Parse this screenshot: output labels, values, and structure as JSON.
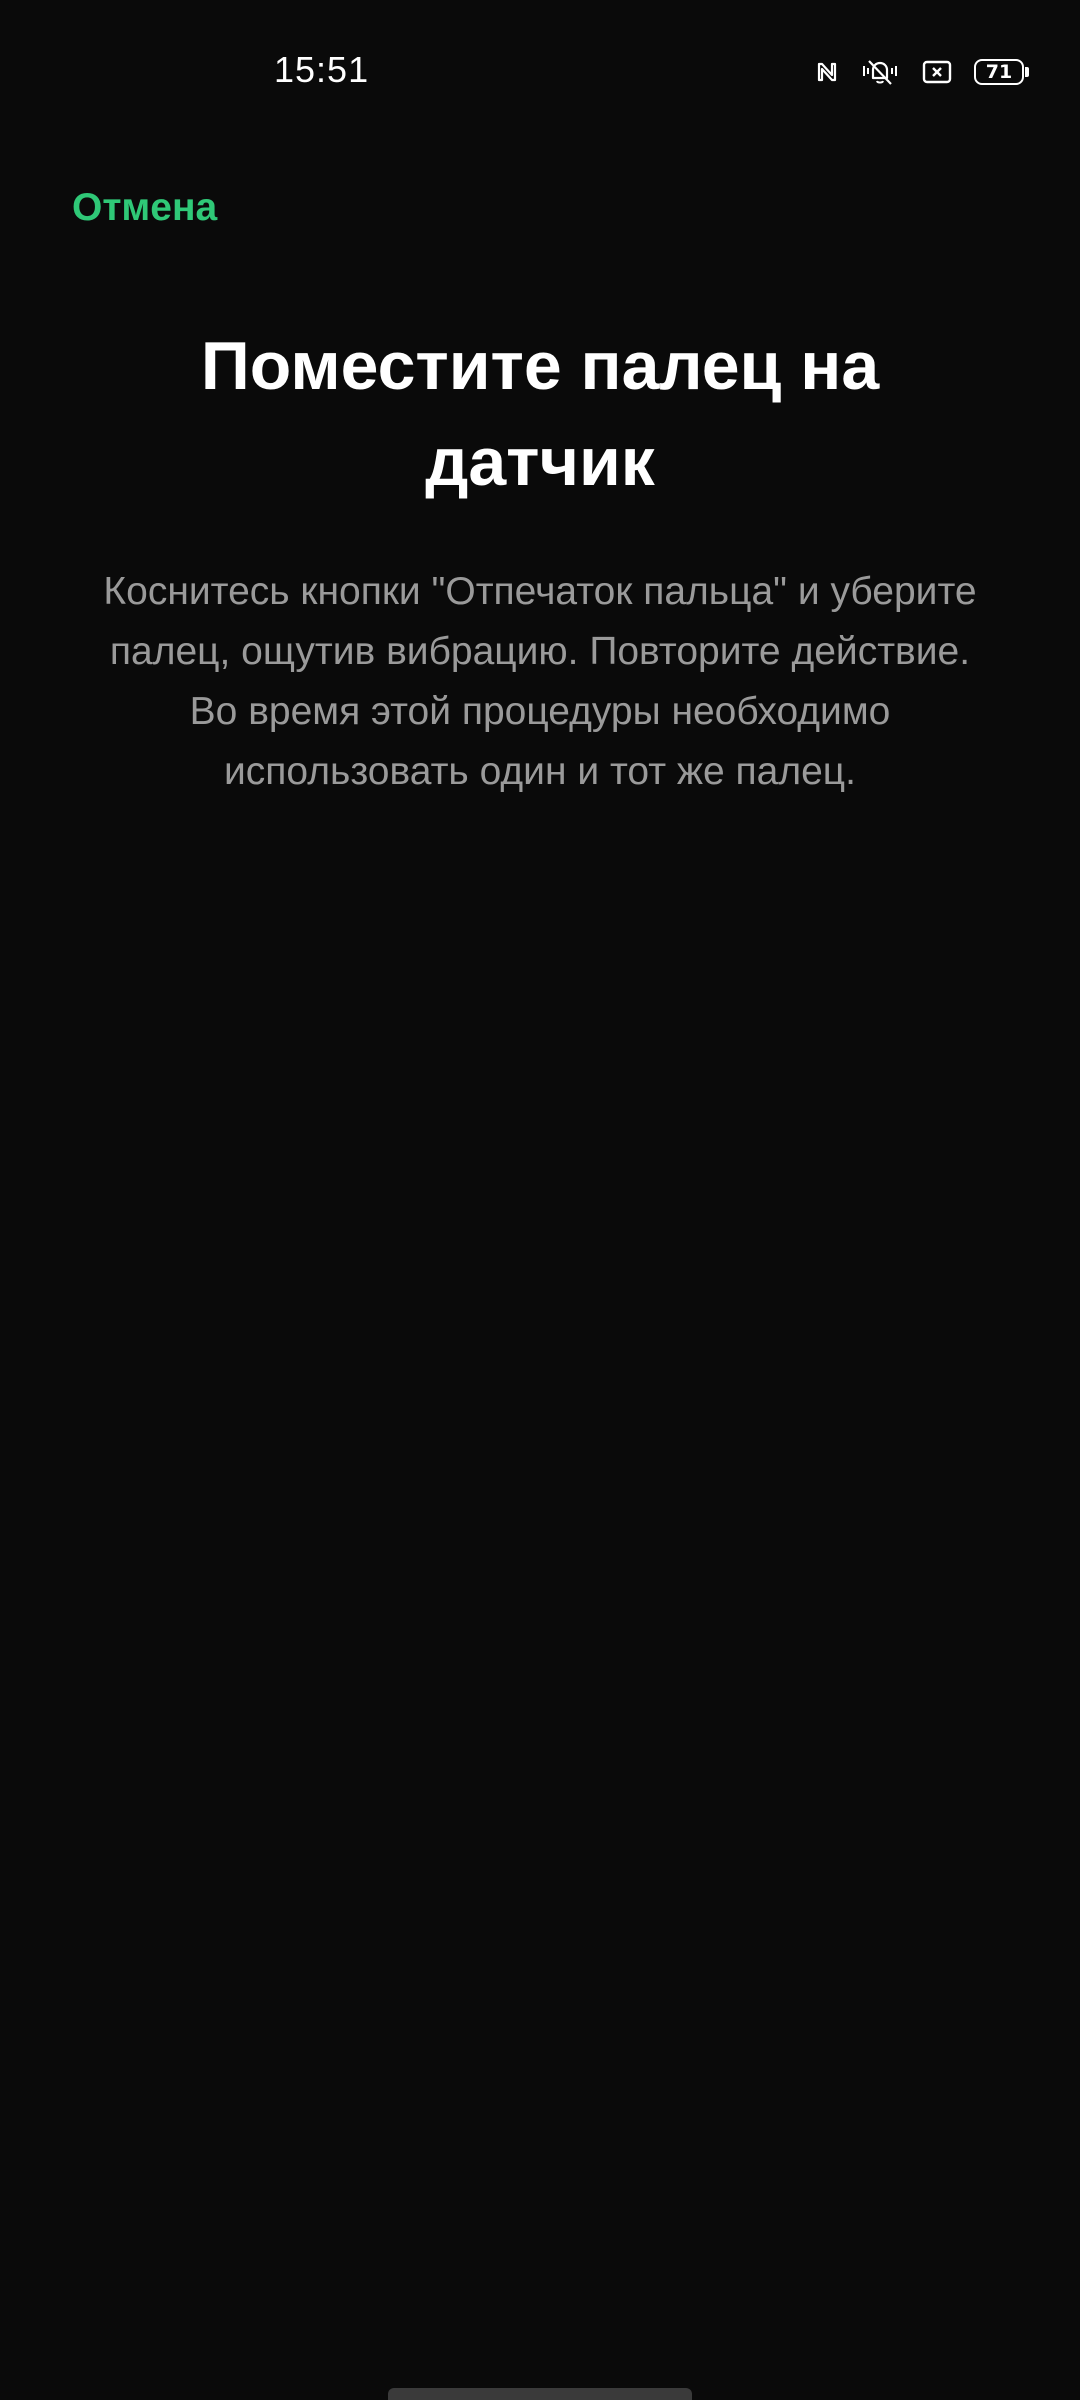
{
  "status_bar": {
    "time": "15:51",
    "battery_level": "71",
    "icons": [
      "nfc-icon",
      "vibrate-silent-icon",
      "screen-record-icon",
      "battery-icon"
    ]
  },
  "header": {
    "cancel_label": "Отмена"
  },
  "main": {
    "title": "Поместите палец на датчик",
    "description_line1": "Коснитесь кнопки \"Отпечаток пальца\" и уберите палец, ощутив вибрацию. Повторите действие.",
    "description_line2": "Во время этой процедуры необходимо использовать один и тот же палец."
  },
  "colors": {
    "background": "#0a0a0a",
    "accent": "#2fc877",
    "title": "#ffffff",
    "description": "#9a9a9a"
  }
}
